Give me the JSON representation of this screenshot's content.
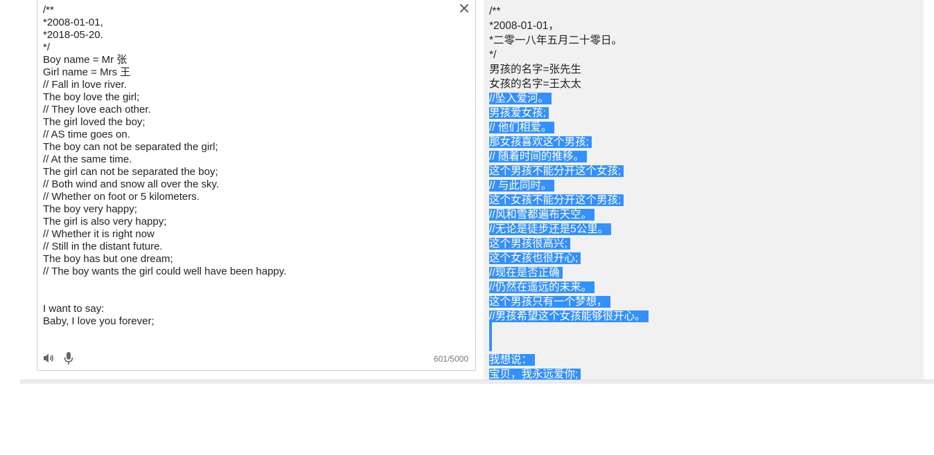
{
  "source": {
    "text": "/**\n*2008-01-01,\n*2018-05-20.\n*/\nBoy name = Mr 张\nGirl name = Mrs 王\n// Fall in love river.\nThe boy love the girl;\n// They love each other.\nThe girl loved the boy;\n// AS time goes on.\nThe boy can not be separated the girl;\n// At the same time.\nThe girl can not be separated the boy;\n// Both wind and snow all over the sky.\n// Whether on foot or 5 kilometers.\nThe boy very happy;\nThe girl is also very happy;\n// Whether it is right now\n// Still in the distant future.\nThe boy has but one dream;\n// The boy wants the girl could well have been happy.\n\n\nI want to say:\nBaby, I love you forever;",
    "char_count": "601/5000",
    "close_icon": "close-icon",
    "speaker_icon": "speaker-icon",
    "mic_icon": "microphone-icon"
  },
  "target": {
    "lines": [
      "/**",
      "*2008-01-01，",
      "*二零一八年五月二十零日。",
      "*/",
      "男孩的名字=张先生",
      "女孩的名字=王太太",
      "//坠入爱河。",
      "男孩爱女孩;",
      "// 他们相爱。",
      "那女孩喜欢这个男孩;",
      "// 随着时间的推移。",
      "这个男孩不能分开这个女孩;",
      "// 与此同时。",
      "这个女孩不能分开这个男孩;",
      "//风和雪都遍布天空。",
      "//无论是徒步还是5公里。",
      "这个男孩很高兴;",
      "这个女孩也很开心;",
      "//现在是否正确",
      "//仍然在遥远的未来。",
      "这个男孩只有一个梦想，",
      "//男孩希望这个女孩能够很开心。",
      "",
      "",
      "我想说：",
      "宝贝，我永远爱你;"
    ],
    "selection_color": "#3390ff"
  }
}
